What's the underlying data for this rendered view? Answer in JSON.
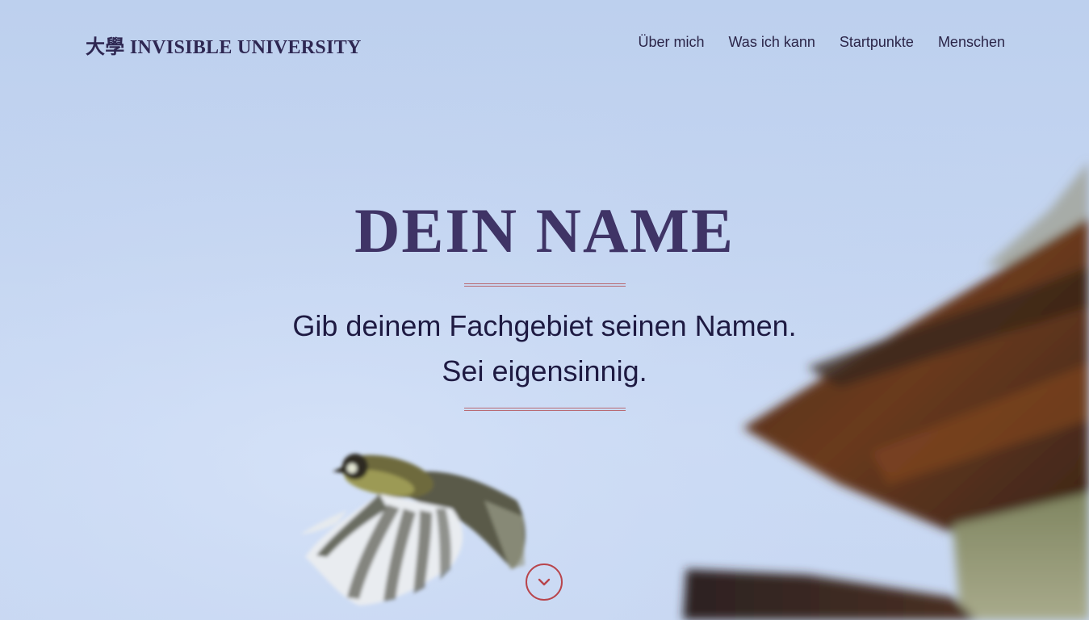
{
  "header": {
    "brand": "大學 INVISIBLE UNIVERSITY",
    "nav": [
      {
        "label": "Über mich"
      },
      {
        "label": "Was ich kann"
      },
      {
        "label": "Startpunkte"
      },
      {
        "label": "Menschen"
      }
    ]
  },
  "hero": {
    "title": "DEIN NAME",
    "tagline_line1": "Gib deinem Fachgebiet seinen Namen.",
    "tagline_line2": "Sei eigensinnig.",
    "background_image": "bird-in-flight-under-roof-eave",
    "scroll_icon": "chevron-down-icon"
  },
  "colors": {
    "sky": "#c4d5f1",
    "title": "#3f3466",
    "text": "#1e1a42",
    "accent": "#b8454c"
  }
}
